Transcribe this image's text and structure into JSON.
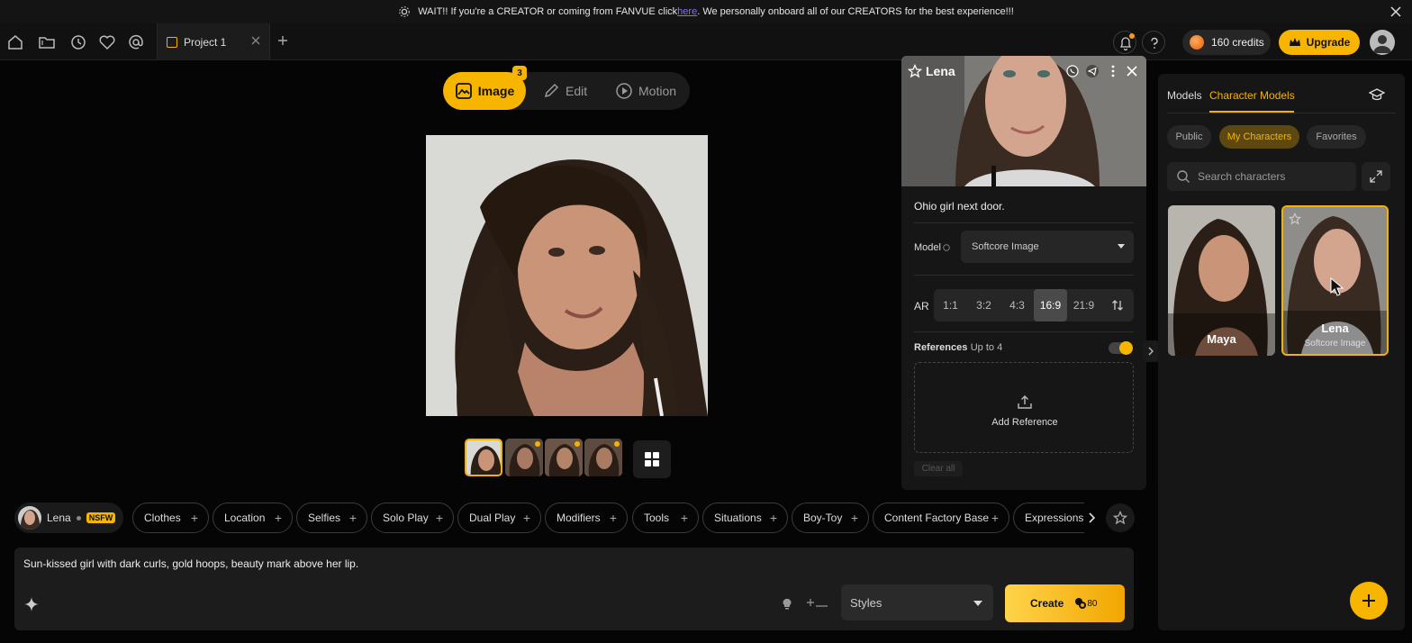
{
  "banner": {
    "text_before": "WAIT!! If you're a CREATOR or coming from FANVUE click ",
    "link_text": "here",
    "text_after": ". We personally onboard all of our CREATORS for the best experience!!!"
  },
  "nav": {
    "tab_label": "Project 1",
    "credits_label": "160 credits",
    "upgrade_label": "Upgrade"
  },
  "modes": {
    "image_label": "Image",
    "edit_label": "Edit",
    "motion_label": "Motion",
    "image_badge": "3"
  },
  "character_panel": {
    "name": "Lena",
    "description": "Ohio girl next door.",
    "model_label": "Model",
    "model_value": "Softcore Image",
    "ar_label": "AR",
    "ar_options": [
      "1:1",
      "3:2",
      "4:3",
      "16:9",
      "21:9"
    ],
    "ar_selected": "16:9",
    "references_label": "References",
    "references_sub": "· Up to 4",
    "add_reference_label": "Add Reference",
    "clear_all_label": "Clear all"
  },
  "sidebar": {
    "tabs": [
      "Models",
      "Character Models"
    ],
    "active_tab": "Character Models",
    "filters": [
      "Public",
      "My Characters",
      "Favorites"
    ],
    "active_filter": "My Characters",
    "search_placeholder": "Search characters",
    "cards": [
      {
        "name": "Maya",
        "subtitle": ""
      },
      {
        "name": "Lena",
        "subtitle": "Softcore Image"
      }
    ]
  },
  "chips_bar": {
    "character": "Lena",
    "nsfw_label": "NSFW",
    "categories": [
      "Clothes",
      "Location",
      "Selfies",
      "Solo Play",
      "Dual Play",
      "Modifiers",
      "Tools",
      "Situations",
      "Boy-Toy",
      "Content Factory Base",
      "Expressions"
    ]
  },
  "prompt": {
    "text": "Sun-kissed girl with dark curls, gold hoops, beauty mark above her lip.",
    "styles_label": "Styles",
    "create_label": "Create",
    "create_cost": "80"
  },
  "colors": {
    "accent": "#f7b500",
    "background": "#050505",
    "panel": "#161616"
  }
}
